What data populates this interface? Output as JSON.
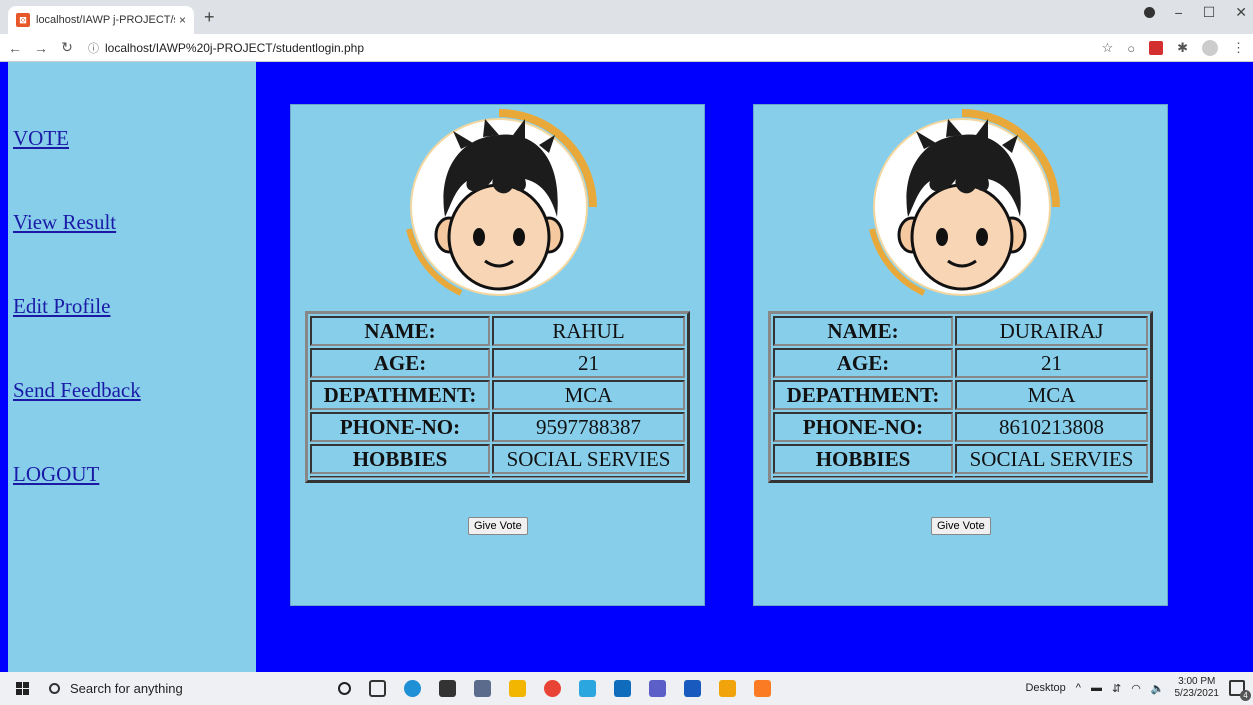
{
  "browser": {
    "tab_title": "localhost/IAWP j-PROJECT/stude",
    "tab_close": "×",
    "new_tab": "+",
    "url": "localhost/IAWP%20j-PROJECT/studentlogin.php"
  },
  "sidebar": {
    "links": [
      "VOTE",
      "View Result",
      "Edit Profile",
      "Send Feedback",
      "LOGOUT"
    ]
  },
  "labels": {
    "name": "NAME:",
    "age": "AGE:",
    "department": "DEPATHMENT:",
    "phone": "PHONE-NO:",
    "hobbies": "HOBBIES"
  },
  "candidates": [
    {
      "name": "RAHUL",
      "age": "21",
      "department": "MCA",
      "phone": "9597788387",
      "hobbies": "SOCIAL SERVIES",
      "button": "Give Vote"
    },
    {
      "name": "DURAIRAJ",
      "age": "21",
      "department": "MCA",
      "phone": "8610213808",
      "hobbies": "SOCIAL SERVIES",
      "button": "Give Vote"
    }
  ],
  "taskbar": {
    "search_placeholder": "Search for anything",
    "desktop_label": "Desktop",
    "time": "3:00 PM",
    "date": "5/23/2021",
    "notification_count": "4"
  },
  "colors": {
    "page_background": "#0000ff",
    "panel_background": "#87ceeb",
    "link_color": "#1a1aa6"
  }
}
